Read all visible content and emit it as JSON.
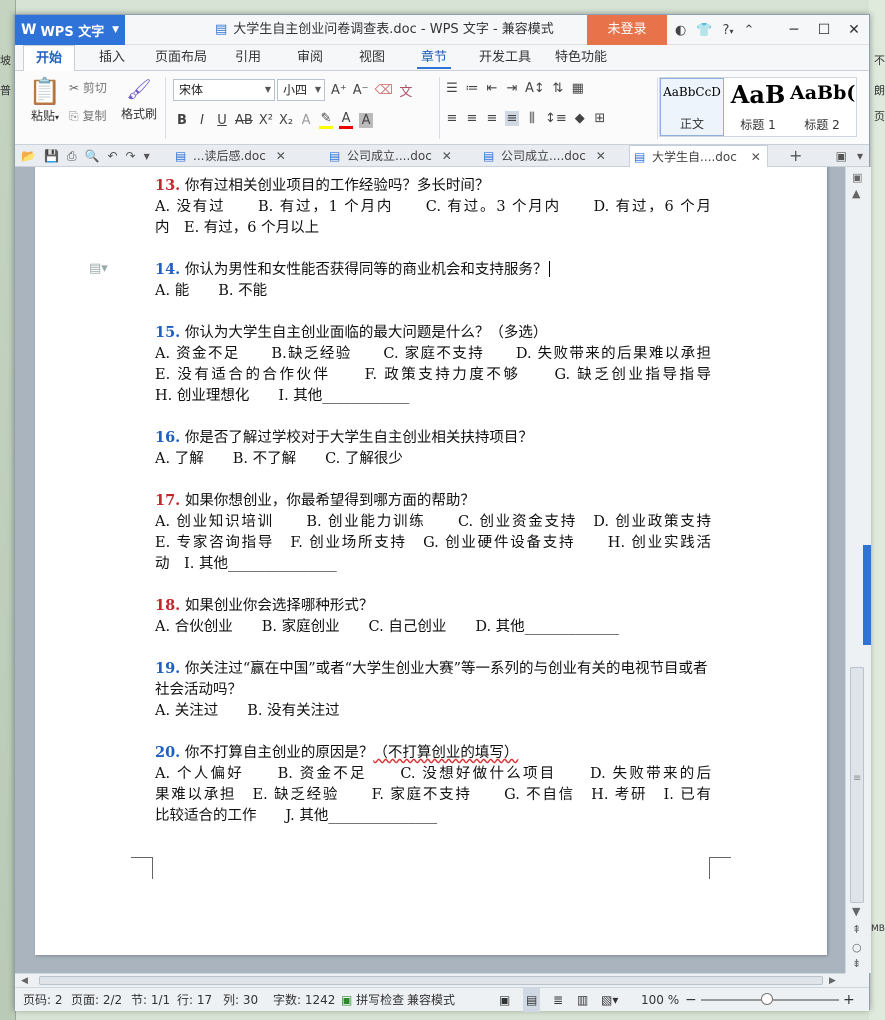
{
  "desktop": {
    "left_labels": [
      "坡",
      "普"
    ],
    "right_labels": [
      "不",
      "朗",
      "页",
      "MB"
    ]
  },
  "titlebar": {
    "app_name": "WPS 文字",
    "title": "大学生自主创业问卷调查表.doc - WPS 文字 - 兼容模式",
    "login_label": "未登录",
    "icons": [
      "skin-icon",
      "shirt-icon",
      "help-icon"
    ],
    "help_label": "?"
  },
  "menu": {
    "tabs": [
      "开始",
      "插入",
      "页面布局",
      "引用",
      "审阅",
      "视图",
      "章节",
      "开发工具",
      "特色功能"
    ],
    "active": "开始",
    "highlight": "章节"
  },
  "ribbon": {
    "paste_label": "粘贴",
    "cut_label": "剪切",
    "copy_label": "复制",
    "format_painter_label": "格式刷",
    "font_name": "宋体",
    "font_size": "小四",
    "styles": [
      {
        "sample": "AaBbCcD",
        "name": "正文"
      },
      {
        "sample": "AaB",
        "name": "标题 1"
      },
      {
        "sample": "AaBb(",
        "name": "标题 2"
      }
    ]
  },
  "doc_tabs": [
    {
      "label": "...读后感.doc",
      "active": false
    },
    {
      "label": "公司成立....doc",
      "active": false
    },
    {
      "label": "公司成立....doc",
      "active": false
    },
    {
      "label": "大学生自....doc",
      "active": true
    }
  ],
  "document": {
    "questions": [
      {
        "num": "13.",
        "title": "你有过相关创业项目的工作经验吗？多长时间？",
        "lines": [
          "A. 没有过　　B. 有过，1 个月内　　C. 有过。3 个月内　　D. 有过，6 个月",
          "内　E. 有过，6 个月以上"
        ]
      },
      {
        "num": "14.",
        "title": "你认为男性和女性能否获得同等的商业机会和支持服务？",
        "lines": [
          "A. 能　　B. 不能"
        ]
      },
      {
        "num": "15.",
        "title": "你认为大学生自主创业面临的最大问题是什么？（多选）",
        "lines": [
          "A. 资金不足　　B.缺乏经验　　C. 家庭不支持　　D. 失败带来的后果难以承担",
          "E. 没有适合的合作伙伴　　F. 政策支持力度不够　　G. 缺乏创业指导指导",
          "H. 创业理想化　　I. 其他____________"
        ]
      },
      {
        "num": "16.",
        "title": "你是否了解过学校对于大学生自主创业相关扶持项目？",
        "lines": [
          "A. 了解　　B. 不了解　　C. 了解很少"
        ]
      },
      {
        "num": "17.",
        "title": "如果你想创业，你最希望得到哪方面的帮助？",
        "lines": [
          "A. 创业知识培训　　B. 创业能力训练　　C. 创业资金支持　D. 创业政策支持",
          "E. 专家咨询指导　F. 创业场所支持　G. 创业硬件设备支持　　H. 创业实践活",
          "动　I. 其他_______________"
        ]
      },
      {
        "num": "18.",
        "title": "如果创业你会选择哪种形式？",
        "lines": [
          "A. 合伙创业　　B. 家庭创业　　C. 自己创业　　D. 其他_____________"
        ]
      },
      {
        "num": "19.",
        "title": "你关注过“赢在中国”或者“大学生创业大赛”等一系列的与创业有关的电视节目或者社会活动吗？",
        "lines": [
          "A. 关注过　　B. 没有关注过"
        ]
      },
      {
        "num": "20.",
        "title": "你不打算自主创业的原因是？",
        "title_note": "（不打算创业的填写）",
        "lines": [
          "A. 个人偏好　　B. 资金不足　　C. 没想好做什么项目　　D. 失败带来的后",
          "果难以承担　E. 缺乏经验　　F. 家庭不支持　　G. 不自信　H. 考研　I. 已有",
          "比较适合的工作　　J. 其他_______________"
        ]
      }
    ]
  },
  "status": {
    "page_num": "页码: 2",
    "pages": "页面: 2/2",
    "section": "节: 1/1",
    "row": "行: 17",
    "col": "列: 30",
    "words": "字数: 1242",
    "spell": "拼写检查",
    "mode": "兼容模式",
    "zoom": "100 %"
  }
}
